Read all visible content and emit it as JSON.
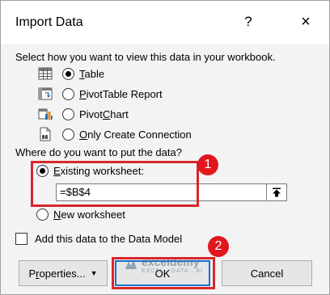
{
  "dialog": {
    "title": "Import Data",
    "help_glyph": "?",
    "close_glyph": "×"
  },
  "view": {
    "instruction": "Select how you want to view this data in your workbook.",
    "options": [
      {
        "label": "Table",
        "selected": true,
        "icon": "table-icon"
      },
      {
        "label": "PivotTable Report",
        "selected": false,
        "icon": "pivottable-icon"
      },
      {
        "label": "PivotChart",
        "selected": false,
        "icon": "pivotchart-icon"
      },
      {
        "label": "Only Create Connection",
        "selected": false,
        "icon": "connection-icon"
      }
    ]
  },
  "location": {
    "question": "Where do you want to put the data?",
    "existing_label": "Existing worksheet:",
    "existing_selected": true,
    "reference_value": "=$B$4",
    "new_label": "New worksheet"
  },
  "datamodel": {
    "label": "Add this data to the Data Model",
    "checked": false
  },
  "buttons": {
    "properties": "Properties...",
    "ok": "OK",
    "cancel": "Cancel"
  },
  "annotations": {
    "badge1": "1",
    "badge2": "2",
    "highlight_color": "#d9262c"
  },
  "watermark": {
    "name": "exceldemy",
    "tagline": "EXCEL · DATA · BI"
  }
}
